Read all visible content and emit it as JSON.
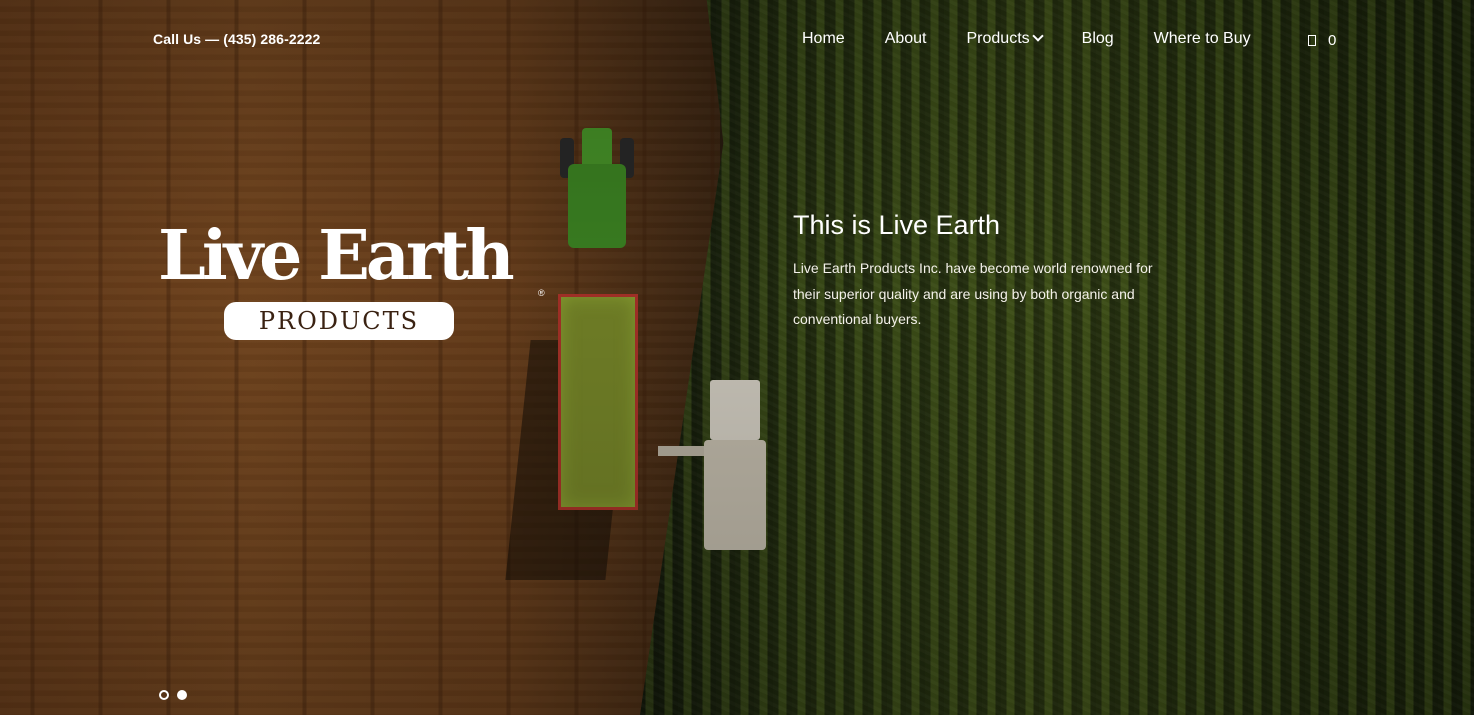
{
  "header": {
    "phone": "Call Us — (435) 286-2222",
    "nav": {
      "items": [
        {
          "label": "Home"
        },
        {
          "label": "About"
        },
        {
          "label": "Products"
        },
        {
          "label": "Blog"
        },
        {
          "label": "Where to Buy"
        }
      ]
    },
    "cart": {
      "icon": "shopping-bag-icon",
      "count": "0"
    }
  },
  "logo": {
    "title": "Live Earth",
    "subtitle": "PRODUCTS",
    "registered": "®"
  },
  "hero": {
    "heading": "This is Live Earth",
    "body": "Live Earth Products Inc. have become world renowned for their superior quality and are using by both organic and conventional buyers."
  },
  "slider": {
    "count": 2,
    "active": 2
  },
  "colors": {
    "text": "#ffffff",
    "soil": "#7b4a20",
    "crop": "#3a4a18",
    "logo_pill_text": "#3a2212"
  }
}
